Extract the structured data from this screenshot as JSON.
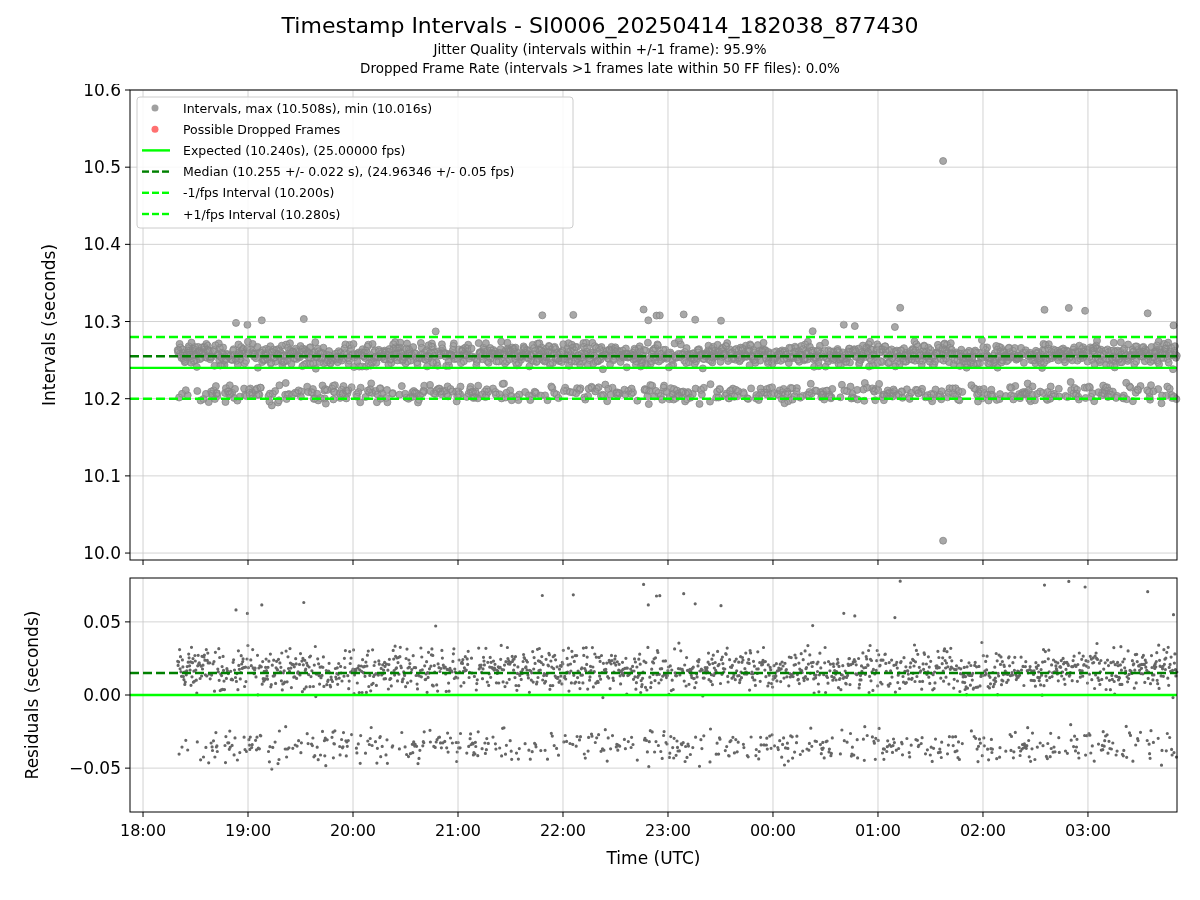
{
  "figure": {
    "title": "Timestamp Intervals - SI0006_20250414_182038_877430",
    "subtitles": [
      "Jitter Quality (intervals within +/-1 frame): 95.9%",
      "Dropped Frame Rate (intervals >1 frames late within 50 FF files): 0.0%"
    ]
  },
  "intervals_plot": {
    "chart_data": {
      "type": "scatter",
      "ylabel": "Intervals (seconds)",
      "grid": true,
      "legend": "upper left",
      "categories": [
        null,
        null,
        null,
        null,
        null,
        null,
        null,
        null,
        null,
        null
      ],
      "ylim": [
        9.991,
        10.6
      ],
      "yticks": [
        {
          "value": 10.0,
          "label": "10.0"
        },
        {
          "value": 10.1,
          "label": "10.1"
        },
        {
          "value": 10.2,
          "label": "10.2"
        },
        {
          "value": 10.3,
          "label": "10.3"
        },
        {
          "value": 10.4,
          "label": "10.4"
        },
        {
          "value": 10.5,
          "label": "10.5"
        },
        {
          "value": 10.6,
          "label": "10.6"
        }
      ],
      "series": [
        {
          "name": "Intervals, max (10.508s), min (10.016s)",
          "color": "#a0a0a0",
          "values": [
            null,
            null,
            null,
            null,
            null,
            null,
            null,
            null,
            null,
            null
          ]
        },
        {
          "name": "Possible Dropped Frames",
          "color": "#ff7070",
          "values": [
            null,
            null,
            null,
            null,
            null,
            null,
            null,
            null,
            null,
            null
          ]
        }
      ],
      "ref_lines": [
        {
          "axis": "y",
          "value": 10.24,
          "label": "Expected (10.240s), (25.00000 fps)",
          "color": "#00ff00"
        },
        {
          "axis": "y",
          "value": 10.255,
          "label": "Median (10.255 +/- 0.022 s), (24.96346 +/- 0.05 fps)",
          "color": "#008000"
        },
        {
          "axis": "y",
          "value": 10.2,
          "label": "-1/fps Interval (10.200s)",
          "color": "#00ff00"
        },
        {
          "axis": "y",
          "value": 10.28,
          "label": "+1/fps Interval (10.280s)",
          "color": "#00ff00"
        }
      ]
    }
  },
  "residuals_plot": {
    "chart_data": {
      "type": "scatter",
      "ylabel": "Residuals (seconds)",
      "xlabel": "Time (UTC)",
      "grid": true,
      "ylim": [
        -0.08,
        0.08
      ],
      "categories": [
        "18:00",
        "19:00",
        "20:00",
        "21:00",
        "22:00",
        "23:00",
        "00:00",
        "01:00",
        "02:00",
        "03:00"
      ],
      "yticks": [
        {
          "value": -0.05,
          "label": "−0.05"
        },
        {
          "value": 0,
          "label": "0.00"
        },
        {
          "value": 0.05,
          "label": "0.05"
        }
      ],
      "ref_lines": [
        {
          "axis": "y",
          "value": 0,
          "color": "#00ff00"
        },
        {
          "axis": "y",
          "value": 0.015,
          "color": "#008000"
        }
      ]
    }
  }
}
